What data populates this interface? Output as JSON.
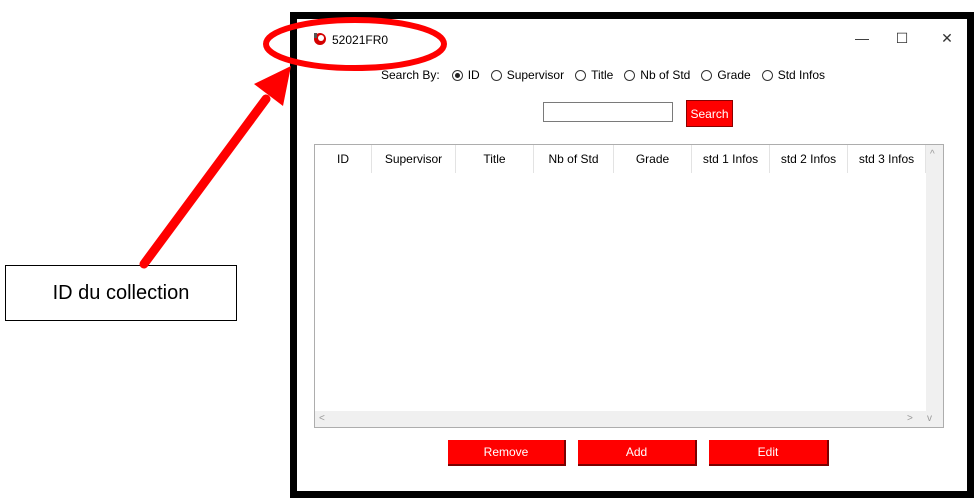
{
  "window": {
    "title": "52021FR0",
    "minimize_icon": "—",
    "maximize_icon": "☐",
    "close_icon": "✕"
  },
  "search": {
    "label": "Search By:",
    "options": [
      {
        "label": "ID",
        "checked": true
      },
      {
        "label": "Supervisor",
        "checked": false
      },
      {
        "label": "Title",
        "checked": false
      },
      {
        "label": "Nb of Std",
        "checked": false
      },
      {
        "label": "Grade",
        "checked": false
      },
      {
        "label": "Std Infos",
        "checked": false
      }
    ],
    "input_value": "",
    "button_label": "Search"
  },
  "table": {
    "columns": [
      "ID",
      "Supervisor",
      "Title",
      "Nb of Std",
      "Grade",
      "std 1 Infos",
      "std 2 Infos",
      "std 3 Infos"
    ],
    "rows": []
  },
  "actions": {
    "remove_label": "Remove",
    "add_label": "Add",
    "edit_label": "Edit"
  },
  "annotation": {
    "callout_text": "ID du collection"
  },
  "colors": {
    "accent": "#ff0000",
    "highlight": "#ff0000",
    "frame": "#000000"
  }
}
